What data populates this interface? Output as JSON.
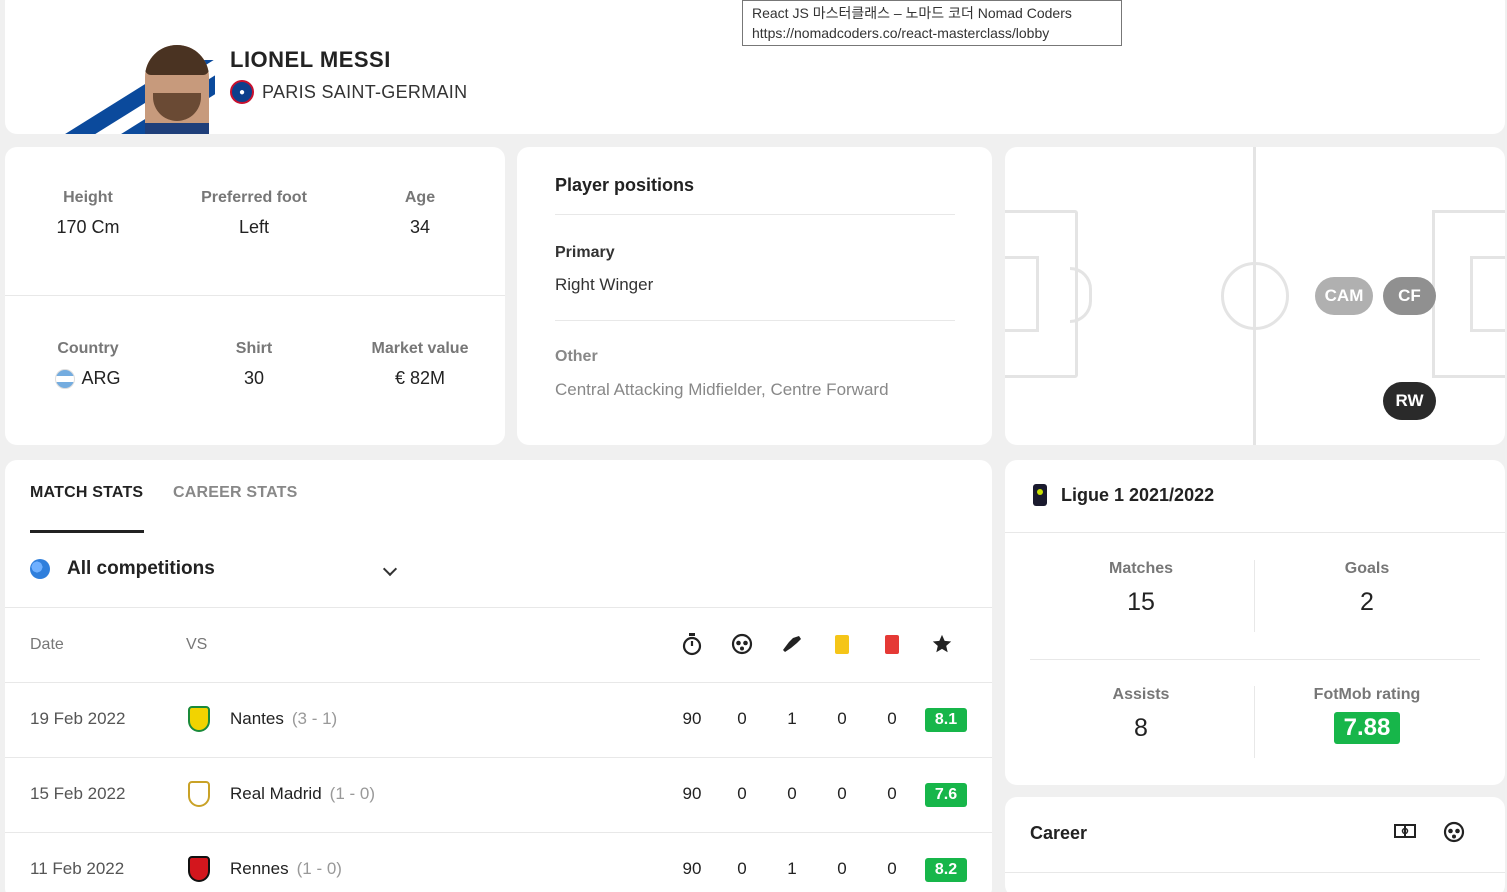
{
  "tooltip": {
    "line1": "React JS 마스터클래스 – 노마드 코더 Nomad Coders",
    "line2": "https://nomadcoders.co/react-masterclass/lobby"
  },
  "player": {
    "name": "LIONEL MESSI",
    "club": "PARIS SAINT-GERMAIN"
  },
  "bio": {
    "height_label": "Height",
    "height_value": "170 Cm",
    "foot_label": "Preferred foot",
    "foot_value": "Left",
    "age_label": "Age",
    "age_value": "34",
    "country_label": "Country",
    "country_value": "ARG",
    "shirt_label": "Shirt",
    "shirt_value": "30",
    "market_label": "Market value",
    "market_value": "€ 82M"
  },
  "positions": {
    "title": "Player positions",
    "primary_label": "Primary",
    "primary_value": "Right Winger",
    "other_label": "Other",
    "other_value": "Central Attacking Midfielder, Centre Forward",
    "pitch_badges": {
      "cam": "CAM",
      "cf": "CF",
      "rw": "RW"
    }
  },
  "stats": {
    "tab_match": "MATCH STATS",
    "tab_career": "CAREER STATS",
    "competition": "All competitions",
    "col_date": "Date",
    "col_vs": "VS",
    "matches": [
      {
        "date": "19 Feb 2022",
        "team": "Nantes",
        "score": "(3 - 1)",
        "minutes": "90",
        "goals": "0",
        "assists": "1",
        "yellow": "0",
        "red": "0",
        "rating": "8.1"
      },
      {
        "date": "15 Feb 2022",
        "team": "Real Madrid",
        "score": "(1 - 0)",
        "minutes": "90",
        "goals": "0",
        "assists": "0",
        "yellow": "0",
        "red": "0",
        "rating": "7.6"
      },
      {
        "date": "11 Feb 2022",
        "team": "Rennes",
        "score": "(1 - 0)",
        "minutes": "90",
        "goals": "0",
        "assists": "1",
        "yellow": "0",
        "red": "0",
        "rating": "8.2"
      }
    ]
  },
  "league": {
    "title": "Ligue 1 2021/2022",
    "matches_label": "Matches",
    "matches_value": "15",
    "goals_label": "Goals",
    "goals_value": "2",
    "assists_label": "Assists",
    "assists_value": "8",
    "rating_label": "FotMob rating",
    "rating_value": "7.88"
  },
  "career": {
    "title": "Career"
  },
  "colors": {
    "rating_green": "#17b64a",
    "psg_blue": "#0d3f8c",
    "yellow_card": "#f5c518",
    "red_card": "#e53935"
  }
}
